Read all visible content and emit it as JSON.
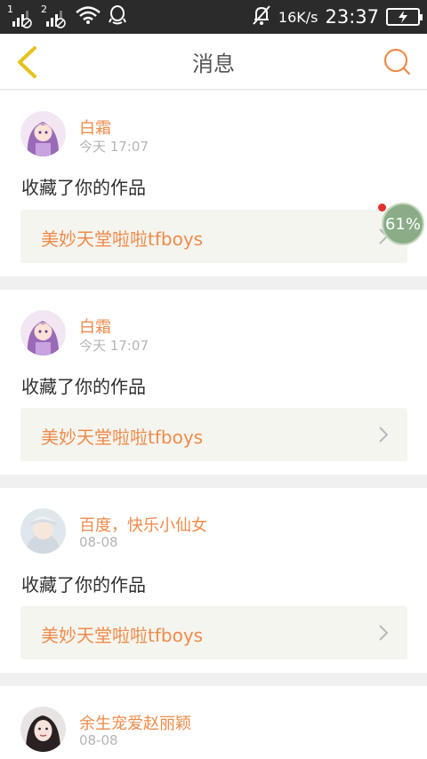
{
  "status_bar": {
    "sim1": "1",
    "sim2": "2",
    "net_speed": "16K/s",
    "time": "23:37"
  },
  "header": {
    "title": "消息"
  },
  "messages": [
    {
      "user": "白霜",
      "time": "今天 17:07",
      "action": "收藏了你的作品",
      "work_title": "美妙天堂啦啦tfboys"
    },
    {
      "user": "白霜",
      "time": "今天 17:07",
      "action": "收藏了你的作品",
      "work_title": "美妙天堂啦啦tfboys"
    },
    {
      "user": "百度，快乐小仙女",
      "time": "08-08",
      "action": "收藏了你的作品",
      "work_title": "美妙天堂啦啦tfboys"
    },
    {
      "user": "余生宠爱赵丽颖",
      "time": "08-08"
    }
  ],
  "floating_badge": {
    "percent_label": "61%",
    "percent": 61
  },
  "colors": {
    "accent": "#ef8b4a",
    "back_icon": "#e7c21c",
    "status_bar_bg": "#2b2b2b",
    "link_box_bg": "#f5f5ef"
  },
  "icons": [
    "signal-icon",
    "wifi-icon",
    "qq-icon",
    "mute-bell-icon",
    "battery-charging-icon",
    "back-chevron-icon",
    "search-icon",
    "chevron-right-icon"
  ]
}
